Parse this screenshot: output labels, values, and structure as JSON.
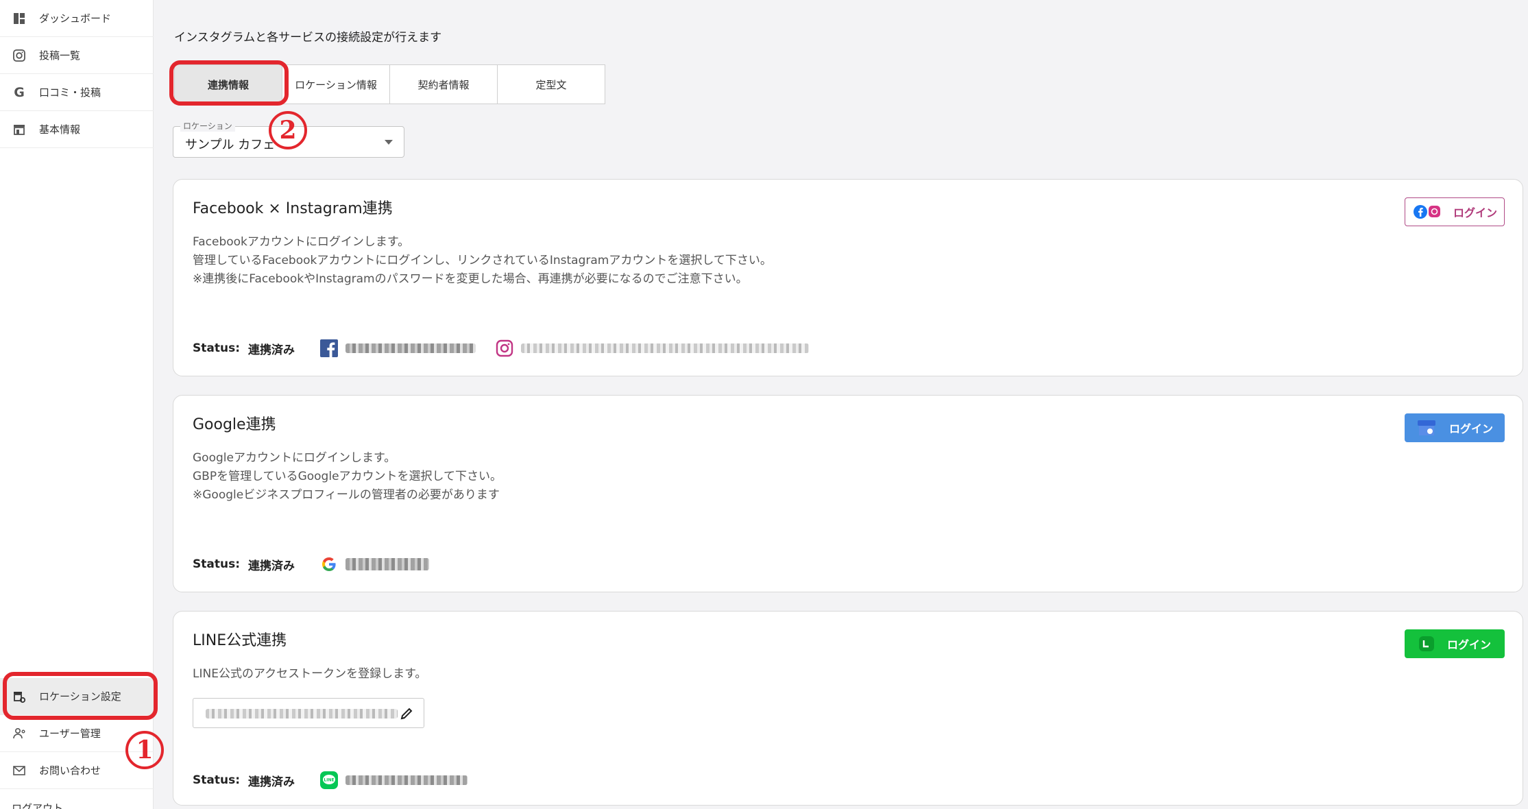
{
  "sidebar": {
    "items": [
      {
        "label": "ダッシュボード",
        "icon": "dashboard-icon"
      },
      {
        "label": "投稿一覧",
        "icon": "instagram-icon"
      },
      {
        "label": "口コミ・投稿",
        "icon": "google-g-icon"
      },
      {
        "label": "基本情報",
        "icon": "store-icon"
      }
    ],
    "bottom_items": [
      {
        "label": "ロケーション設定",
        "icon": "location-settings-icon",
        "active": true
      },
      {
        "label": "ユーザー管理",
        "icon": "user-manage-icon"
      },
      {
        "label": "お問い合わせ",
        "icon": "mail-icon"
      },
      {
        "label": "ログアウト",
        "icon": "logout-icon"
      }
    ]
  },
  "annotations": {
    "step1": "1",
    "step2": "2",
    "color": "#e3262d"
  },
  "main": {
    "intro": "インスタグラムと各サービスの接続設定が行えます",
    "tabs": [
      {
        "label": "連携情報",
        "active": true
      },
      {
        "label": "ロケーション情報"
      },
      {
        "label": "契約者情報"
      },
      {
        "label": "定型文"
      }
    ],
    "location_select": {
      "label": "ロケーション",
      "value": "サンプル カフェ"
    },
    "cards": {
      "facebook": {
        "title": "Facebook × Instagram連携",
        "desc": [
          "Facebookアカウントにログインします。",
          "管理しているFacebookアカウントにログインし、リンクされているInstagramアカウントを選択して下さい。",
          "※連携後にFacebookやInstagramのパスワードを変更した場合、再連携が必要になるのでご注意下さい。"
        ],
        "login": "ログイン",
        "status_label": "Status:",
        "status_value": "連携済み"
      },
      "google": {
        "title": "Google連携",
        "desc": [
          "Googleアカウントにログインします。",
          "GBPを管理しているGoogleアカウントを選択して下さい。",
          "※Googleビジネスプロフィールの管理者の必要があります"
        ],
        "login": "ログイン",
        "status_label": "Status:",
        "status_value": "連携済み"
      },
      "line": {
        "title": "LINE公式連携",
        "desc": [
          "LINE公式のアクセストークンを登録します。"
        ],
        "login": "ログイン",
        "status_label": "Status:",
        "status_value": "連携済み"
      }
    }
  },
  "colors": {
    "accent_red": "#e3262d",
    "google_blue": "#4a90e2",
    "line_green": "#14c13c",
    "instagram": "#b03a7a",
    "facebook": "#1877f2"
  }
}
